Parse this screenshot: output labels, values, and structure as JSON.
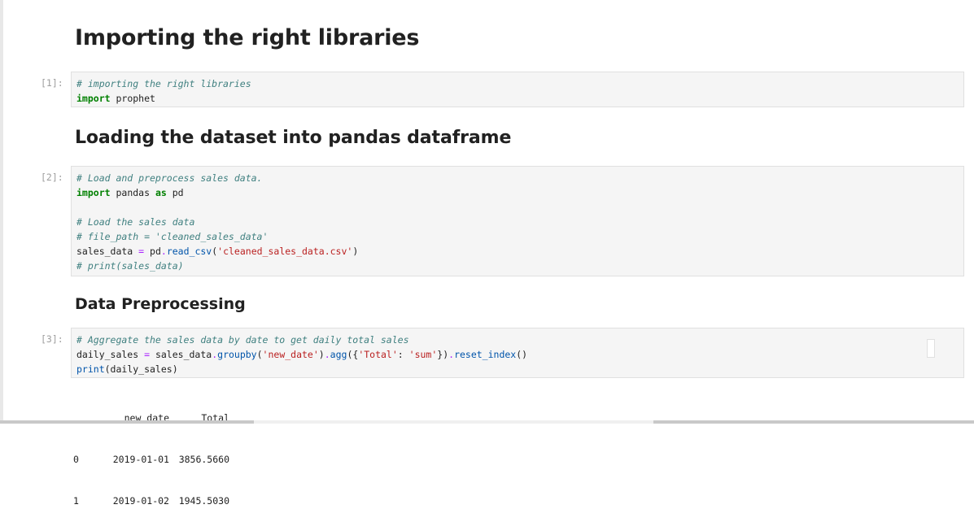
{
  "headings": {
    "h1": "Importing the right libraries",
    "h2": "Loading the dataset into pandas dataframe",
    "h3": "Data Preprocessing"
  },
  "cells": [
    {
      "prompt": "[1]:",
      "lines": [
        [
          {
            "t": "cm",
            "v": "# importing the right libraries"
          }
        ],
        [
          {
            "t": "kw",
            "v": "import"
          },
          {
            "t": "",
            "v": " prophet"
          }
        ]
      ]
    },
    {
      "prompt": "[2]:",
      "lines": [
        [
          {
            "t": "cm",
            "v": "# Load and preprocess sales data."
          }
        ],
        [
          {
            "t": "kw",
            "v": "import"
          },
          {
            "t": "",
            "v": " pandas "
          },
          {
            "t": "kw",
            "v": "as"
          },
          {
            "t": "",
            "v": " pd"
          }
        ],
        [
          {
            "t": "",
            "v": ""
          }
        ],
        [
          {
            "t": "cm",
            "v": "# Load the sales data"
          }
        ],
        [
          {
            "t": "cm",
            "v": "# file_path = 'cleaned_sales_data'"
          }
        ],
        [
          {
            "t": "",
            "v": "sales_data "
          },
          {
            "t": "op",
            "v": "="
          },
          {
            "t": "",
            "v": " pd"
          },
          {
            "t": "op",
            "v": "."
          },
          {
            "t": "fn",
            "v": "read_csv"
          },
          {
            "t": "",
            "v": "("
          },
          {
            "t": "st",
            "v": "'cleaned_sales_data.csv'"
          },
          {
            "t": "",
            "v": ")"
          }
        ],
        [
          {
            "t": "cm",
            "v": "# print(sales_data)"
          }
        ]
      ]
    },
    {
      "prompt": "[3]:",
      "lines": [
        [
          {
            "t": "cm",
            "v": "# Aggregate the sales data by date to get daily total sales"
          }
        ],
        [
          {
            "t": "",
            "v": "daily_sales "
          },
          {
            "t": "op",
            "v": "="
          },
          {
            "t": "",
            "v": " sales_data"
          },
          {
            "t": "op",
            "v": "."
          },
          {
            "t": "fn",
            "v": "groupby"
          },
          {
            "t": "",
            "v": "("
          },
          {
            "t": "st",
            "v": "'new_date'"
          },
          {
            "t": "",
            "v": ")"
          },
          {
            "t": "op",
            "v": "."
          },
          {
            "t": "fn",
            "v": "agg"
          },
          {
            "t": "",
            "v": "({"
          },
          {
            "t": "st",
            "v": "'Total'"
          },
          {
            "t": "",
            "v": ": "
          },
          {
            "t": "st",
            "v": "'sum'"
          },
          {
            "t": "",
            "v": "})"
          },
          {
            "t": "op",
            "v": "."
          },
          {
            "t": "fn",
            "v": "reset_index"
          },
          {
            "t": "",
            "v": "()"
          }
        ],
        [
          {
            "t": "fn",
            "v": "print"
          },
          {
            "t": "",
            "v": "(daily_sales)"
          }
        ]
      ]
    }
  ],
  "output": {
    "columns": [
      "",
      "new_date",
      "Total"
    ],
    "rows": [
      [
        "0",
        "2019-01-01",
        "3856.5660"
      ],
      [
        "1",
        "2019-01-02",
        "1945.5030"
      ]
    ]
  }
}
